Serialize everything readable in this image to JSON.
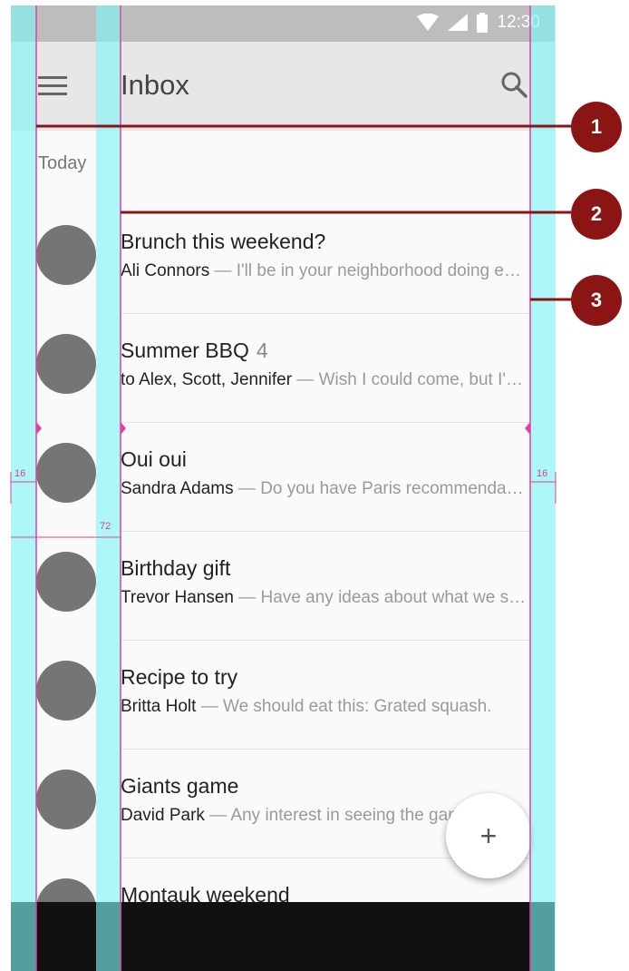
{
  "status_bar": {
    "time": "12:30",
    "icons": [
      "wifi-icon",
      "signal-icon",
      "battery-icon"
    ]
  },
  "app_bar": {
    "title": "Inbox",
    "menu_icon": "menu-icon",
    "search_icon": "search-icon"
  },
  "list": {
    "subheader": "Today",
    "items": [
      {
        "title": "Brunch this weekend?",
        "count": "",
        "sender": "Ali Connors",
        "preview": " — I'll be in your neighborhood doing errands this weekend."
      },
      {
        "title": "Summer BBQ",
        "count": "4",
        "sender": "to Alex, Scott, Jennifer",
        "preview": " — Wish I could come, but I'm out of town."
      },
      {
        "title": "Oui oui",
        "count": "",
        "sender": "Sandra Adams",
        "preview": " — Do you have Paris recommendations?"
      },
      {
        "title": "Birthday gift",
        "count": "",
        "sender": "Trevor Hansen",
        "preview": " — Have any ideas about what we should get?"
      },
      {
        "title": "Recipe to try",
        "count": "",
        "sender": "Britta Holt",
        "preview": " — We should eat this: Grated squash."
      },
      {
        "title": "Giants game",
        "count": "",
        "sender": "David Park",
        "preview": " — Any interest in seeing the game?"
      },
      {
        "title": "Montauk weekend",
        "count": "",
        "sender": "",
        "preview": ""
      }
    ]
  },
  "fab": {
    "label": "+"
  },
  "annotations": {
    "callouts": [
      "1",
      "2",
      "3"
    ],
    "keyline_left": "16",
    "keyline_content": "72",
    "keyline_right": "16"
  },
  "colors": {
    "keyline_cyan": "#7ff5f5",
    "keyline_magenta": "#e040a0",
    "callout": "#8b1414",
    "avatar": "#757575"
  }
}
